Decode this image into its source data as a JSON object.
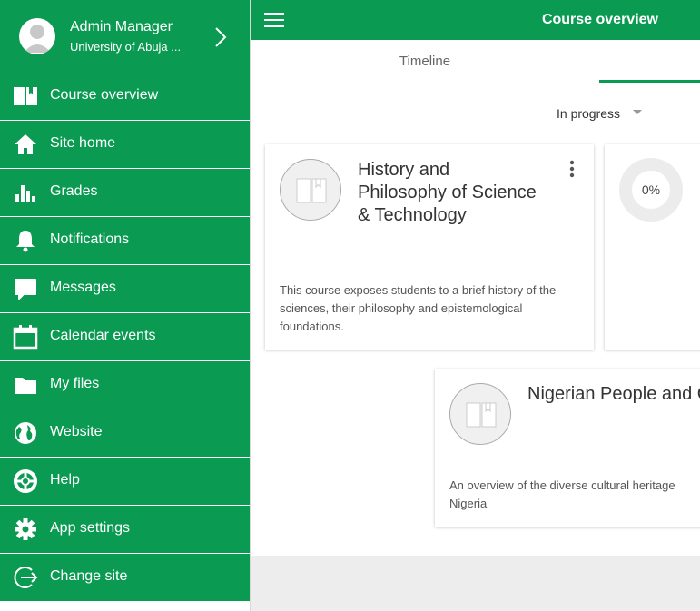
{
  "profile": {
    "name": "Admin Manager",
    "site": "University of Abuja ..."
  },
  "menu": [
    {
      "label": "Course overview",
      "icon": "book-icon"
    },
    {
      "label": "Site home",
      "icon": "home-icon"
    },
    {
      "label": "Grades",
      "icon": "bar-chart-icon"
    },
    {
      "label": "Notifications",
      "icon": "bell-icon"
    },
    {
      "label": "Messages",
      "icon": "chat-bubble-icon"
    },
    {
      "label": "Calendar events",
      "icon": "calendar-icon"
    },
    {
      "label": "My files",
      "icon": "folder-icon"
    },
    {
      "label": "Website",
      "icon": "globe-icon"
    },
    {
      "label": "Help",
      "icon": "lifebuoy-icon"
    },
    {
      "label": "App settings",
      "icon": "gear-icon"
    },
    {
      "label": "Change site",
      "icon": "exit-icon"
    }
  ],
  "header": {
    "title": "Course overview"
  },
  "tabs": {
    "timeline": "Timeline"
  },
  "filter": {
    "selected": "In progress"
  },
  "courses": [
    {
      "title": "History and Philosophy of Science & Technology",
      "summary": "This course exposes students to a brief history of the sciences, their philosophy and epistemological foundations."
    },
    {
      "progress": "0%"
    },
    {
      "title": "Nigerian People and Culture",
      "summary": "An overview of the diverse cultural heritage Nigeria"
    }
  ],
  "colors": {
    "brand": "#0a9a52",
    "background": "#f3f3f3"
  }
}
